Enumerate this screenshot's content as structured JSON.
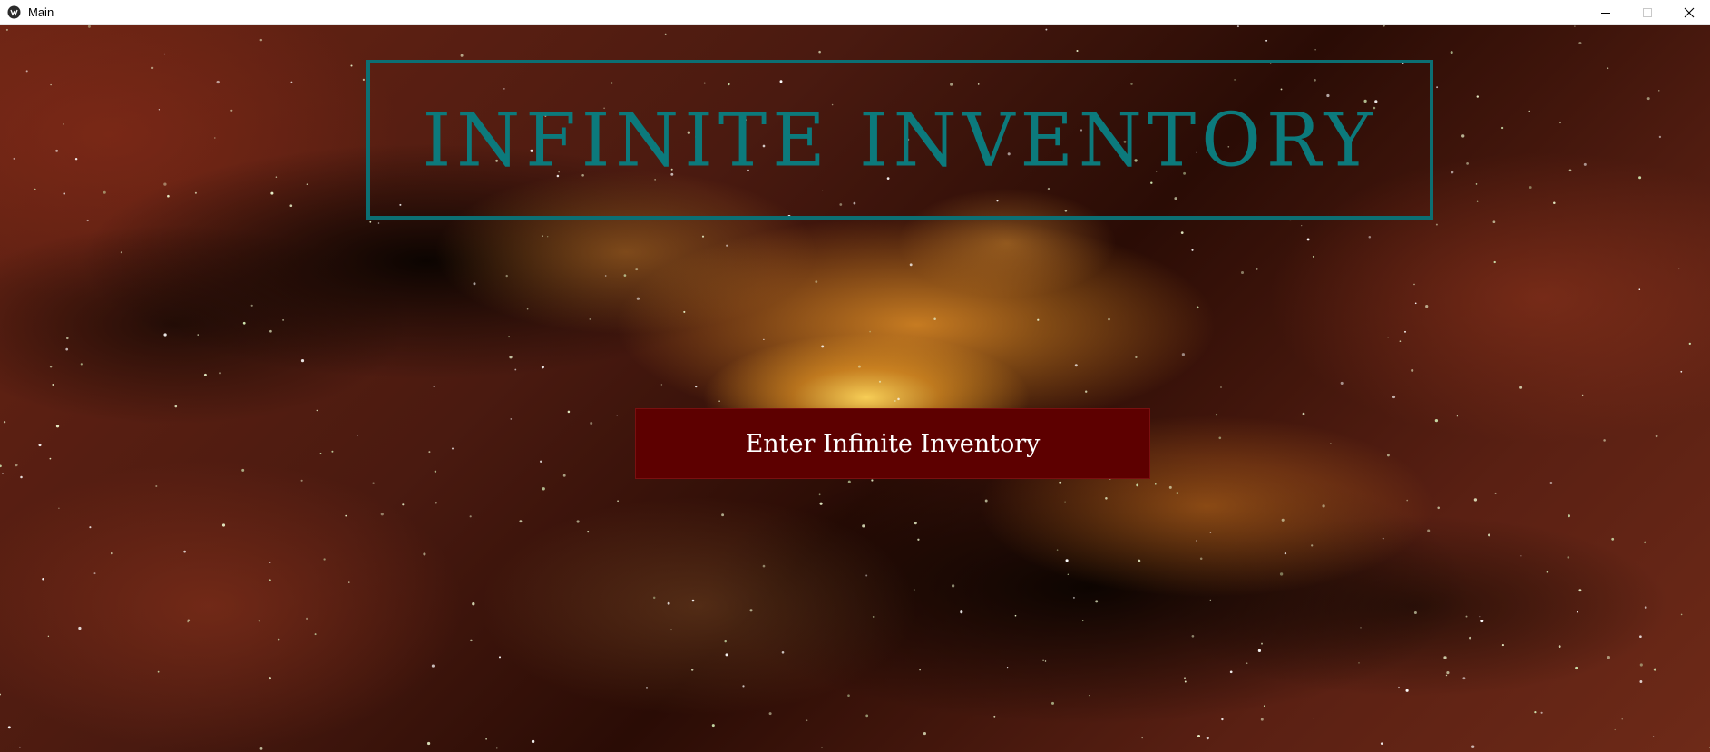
{
  "window": {
    "title": "Main",
    "icons": {
      "app": "app-logo-icon",
      "minimize": "minimize-icon",
      "maximize": "maximize-icon",
      "close": "close-icon"
    }
  },
  "main": {
    "title": "INFINITE INVENTORY",
    "enter_button_label": "Enter Infinite Inventory"
  },
  "colors": {
    "title_teal": "#0c7a7c",
    "button_red": "#5d0000",
    "button_text": "#ffffff"
  }
}
